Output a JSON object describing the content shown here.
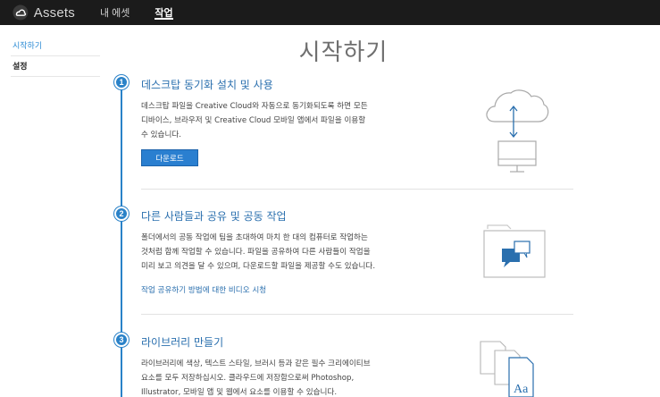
{
  "header": {
    "brand": "Assets",
    "tabs": [
      {
        "label": "내 에셋",
        "active": false
      },
      {
        "label": "작업",
        "active": true
      }
    ]
  },
  "sidebar": {
    "items": [
      {
        "label": "시작하기",
        "active": true
      },
      {
        "label": "설정",
        "active": false
      }
    ]
  },
  "main": {
    "title": "시작하기",
    "steps": [
      {
        "number": "1",
        "title": "데스크탑 동기화 설치 및 사용",
        "lines": [
          "데스크탑 파일을 Creative Cloud와 자동으로 동기화되도록 하면 모든",
          "디바이스, 브라우저 및 Creative Cloud 모바일 앱에서 파일을 이용할",
          "수 있습니다."
        ],
        "button": "다운로드"
      },
      {
        "number": "2",
        "title": "다른 사람들과 공유 및 공동 작업",
        "lines": [
          "폴더에서의 공동 작업에 팀을 초대하여 마치 한 대의 컴퓨터로 작업하는",
          "것처럼 함께 작업할 수 있습니다. 파일을 공유하여 다른 사람들이 작업을",
          "미리 보고 의견을 달 수 있으며, 다운로드할 파일을 제공할 수도 있습니다."
        ],
        "link": "작업 공유하기 방법에 대한 비디오 시청"
      },
      {
        "number": "3",
        "title": "라이브러리 만들기",
        "lines": [
          "라이브러리에 색상, 텍스트 스타일, 브러시 등과 같은 필수 크리에이티브",
          "요소를 모두 저장하십시오. 클라우드에 저장함으로써 Photoshop,",
          "Illustrator, 모바일 앱 및 웹에서 요소를 이용할 수 있습니다."
        ]
      }
    ],
    "illustration_text": "Aa"
  },
  "colors": {
    "topbar": "#1b1b1b",
    "accent": "#2a82c8",
    "link": "#2a6fae"
  }
}
